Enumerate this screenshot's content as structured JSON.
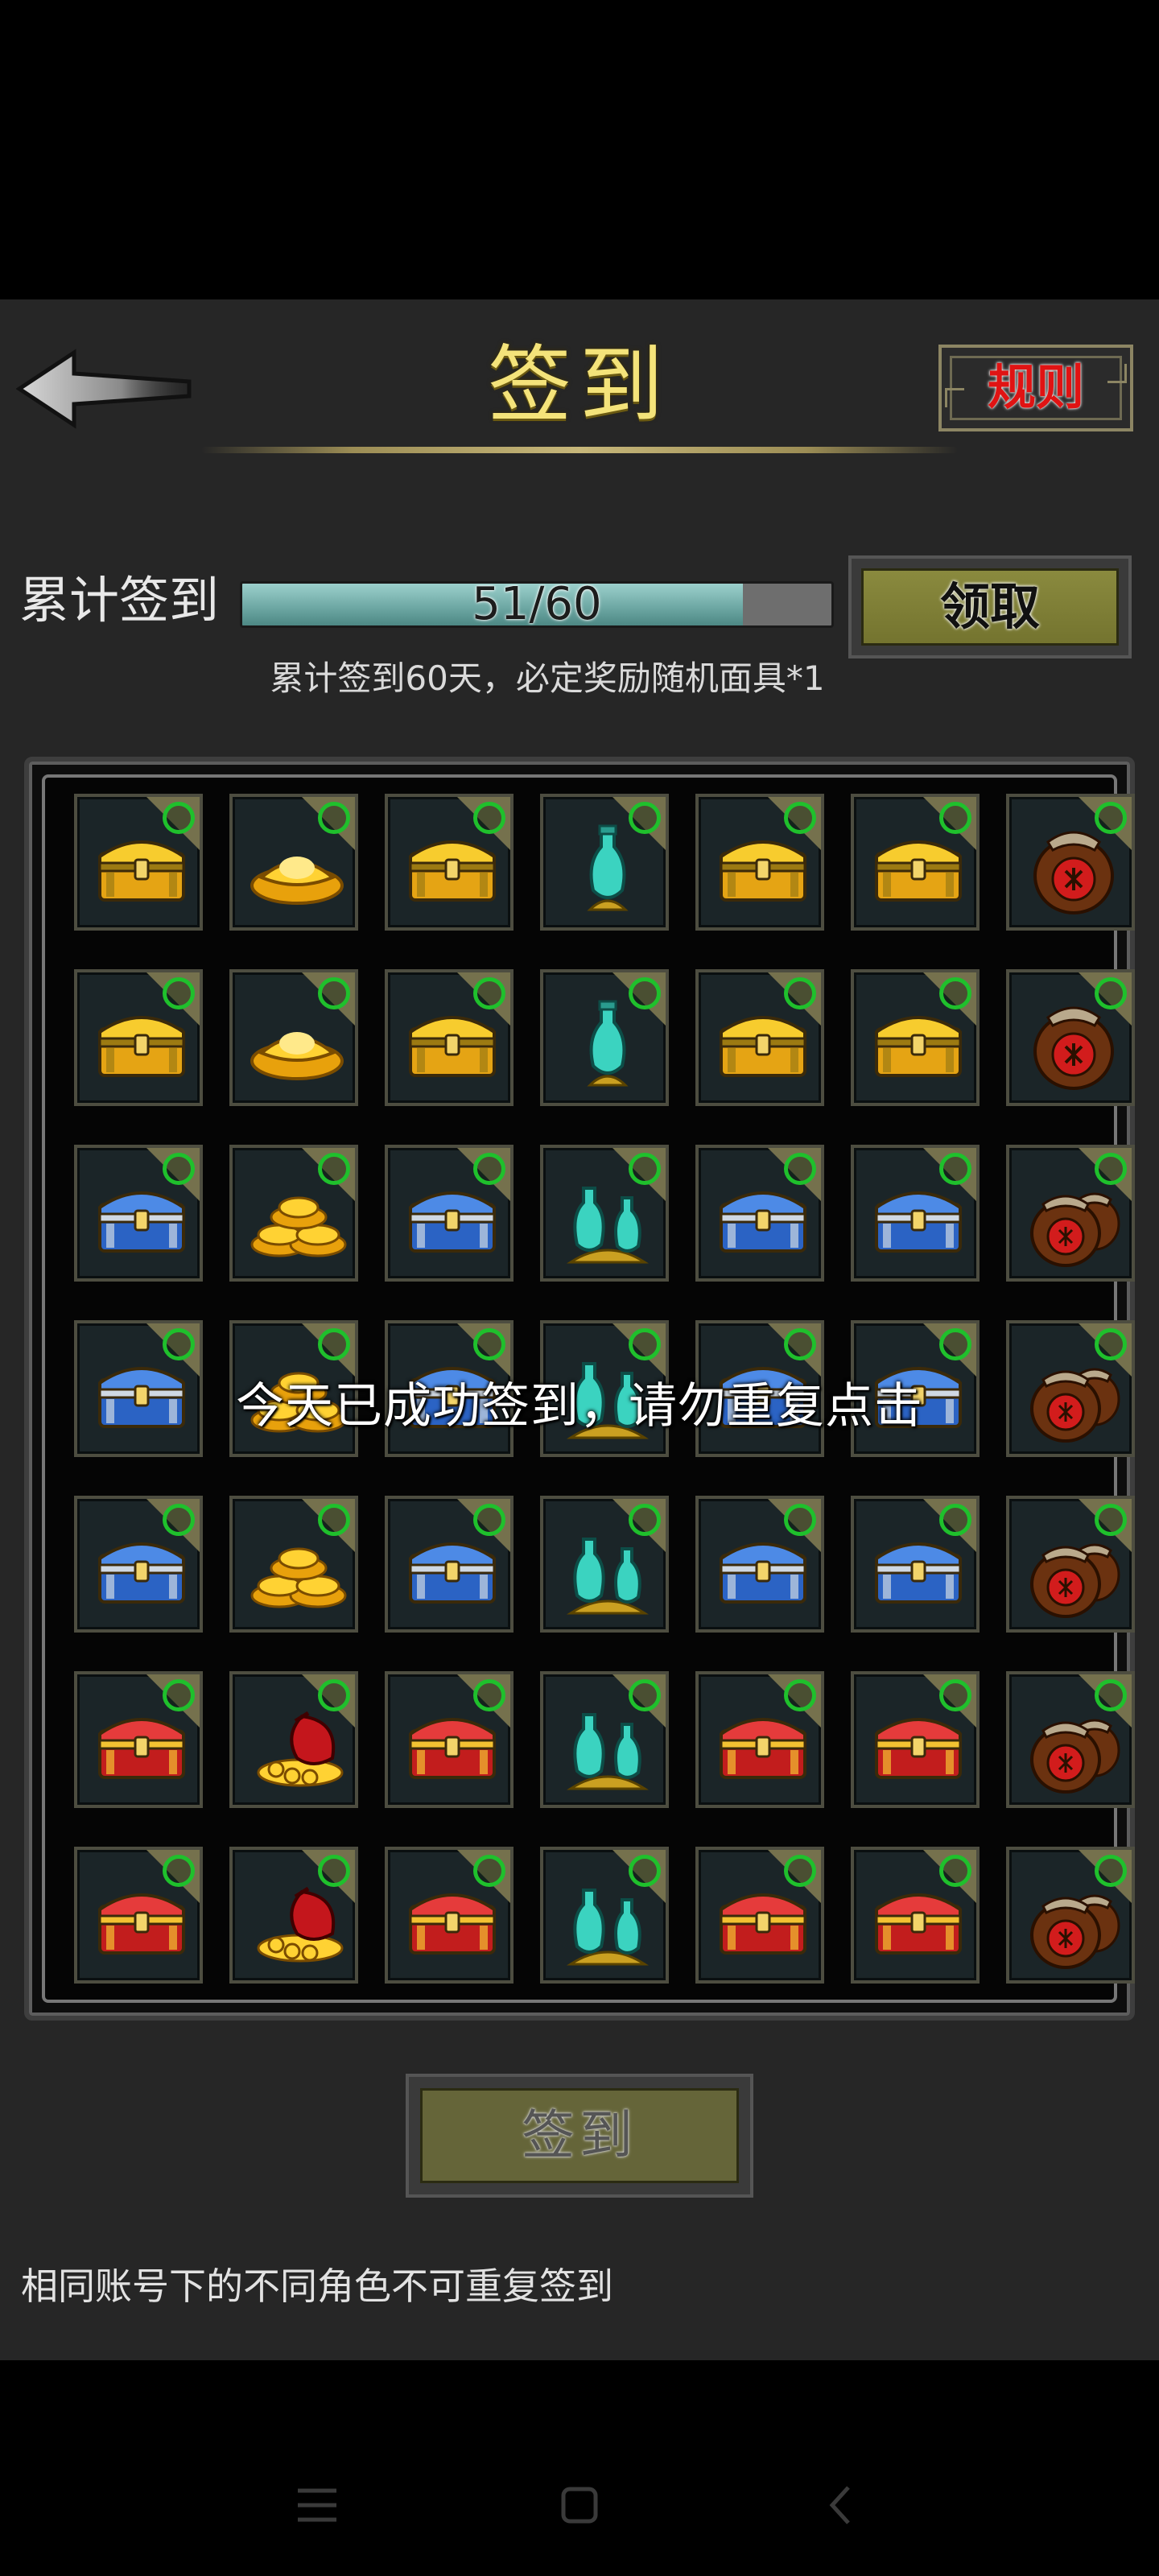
{
  "header": {
    "title": "签到",
    "rules_label": "规则"
  },
  "progress": {
    "label": "累计签到",
    "text": "51/60",
    "current": 51,
    "total": 60,
    "fraction": 0.85,
    "claim_label": "领取",
    "bonus_note": "累计签到60天，必定奖励随机面具*1"
  },
  "grid": {
    "rows": [
      [
        "gold-chest-icon",
        "gold-ingot-icon",
        "gold-chest-icon",
        "teal-vase-icon",
        "gold-chest-icon",
        "gold-chest-icon",
        "wine-jar-icon"
      ],
      [
        "gold-chest-icon",
        "gold-ingot-icon",
        "gold-chest-icon",
        "teal-vase-icon",
        "gold-chest-icon",
        "gold-chest-icon",
        "wine-jar-icon"
      ],
      [
        "blue-chest-icon",
        "gold-ingots-pile-icon",
        "blue-chest-icon",
        "teal-vases-icon",
        "blue-chest-icon",
        "blue-chest-icon",
        "wine-jars-icon"
      ],
      [
        "blue-chest-icon",
        "gold-ingots-pile-icon",
        "blue-chest-icon",
        "teal-vases-icon",
        "blue-chest-icon",
        "blue-chest-icon",
        "wine-jars-icon"
      ],
      [
        "blue-chest-icon",
        "gold-ingots-pile-icon",
        "blue-chest-icon",
        "teal-vases-icon",
        "blue-chest-icon",
        "blue-chest-icon",
        "wine-jars-icon"
      ],
      [
        "red-chest-icon",
        "money-bag-icon",
        "red-chest-icon",
        "teal-vases-icon",
        "red-chest-icon",
        "red-chest-icon",
        "wine-jars-icon"
      ],
      [
        "red-chest-icon",
        "money-bag-icon",
        "red-chest-icon",
        "teal-vases-icon",
        "red-chest-icon",
        "red-chest-icon",
        "wine-jars-icon"
      ]
    ],
    "signed_count": 51
  },
  "toast": "今天已成功签到，请勿重复点击",
  "signin_label": "签到",
  "footer_note": "相同账号下的不同角色不可重复签到",
  "colors": {
    "title": "#f4e37a",
    "check": "#1fc02c",
    "rules": "#e01313",
    "progress_fill": "#6fa9a5"
  },
  "navbar": {
    "icons": [
      "menu-icon",
      "home-icon",
      "back-icon"
    ]
  }
}
